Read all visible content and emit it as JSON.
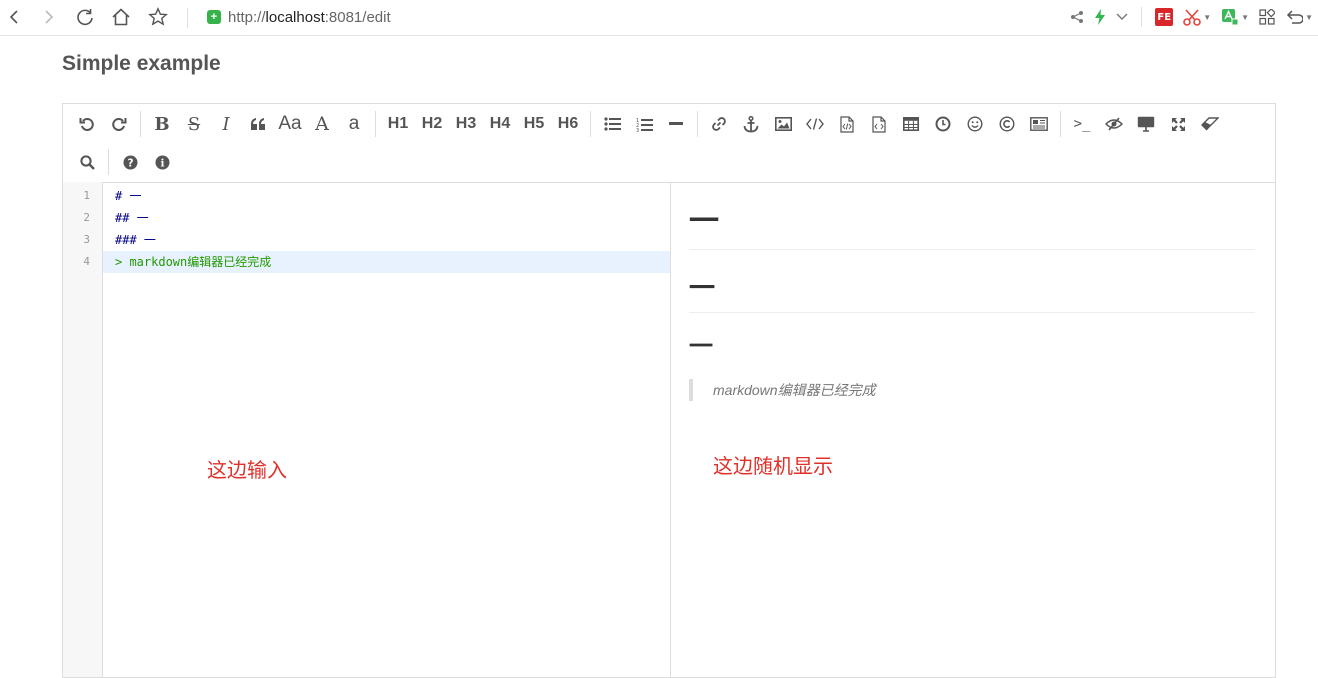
{
  "browser": {
    "url_scheme": "http://",
    "url_host": "localhost",
    "url_rest": ":8081/edit",
    "extension_badge": "FE"
  },
  "page": {
    "title": "Simple example"
  },
  "toolbar": {
    "heading_buttons": [
      "H1",
      "H2",
      "H3",
      "H4",
      "H5",
      "H6"
    ],
    "bold_label": "B",
    "strike_label": "S",
    "italic_label": "I",
    "uppercase_label": "Aa",
    "ucwords_label": "A",
    "lowercase_label": "a",
    "terminal_label": ">_"
  },
  "editor": {
    "line_numbers": [
      "1",
      "2",
      "3",
      "4"
    ],
    "lines": [
      "# 一",
      "## 一",
      "### 一",
      "> markdown编辑器已经完成"
    ]
  },
  "preview": {
    "h1": "一",
    "h2": "一",
    "h3": "一",
    "blockquote": "markdown编辑器已经完成"
  },
  "annotations": {
    "left": "这边输入",
    "right": "这边随机显示"
  },
  "colors": {
    "annotation": "#e0302a",
    "active_line_bg": "#e8f2ff",
    "quote_text": "#229900",
    "heading_text": "#000088"
  }
}
